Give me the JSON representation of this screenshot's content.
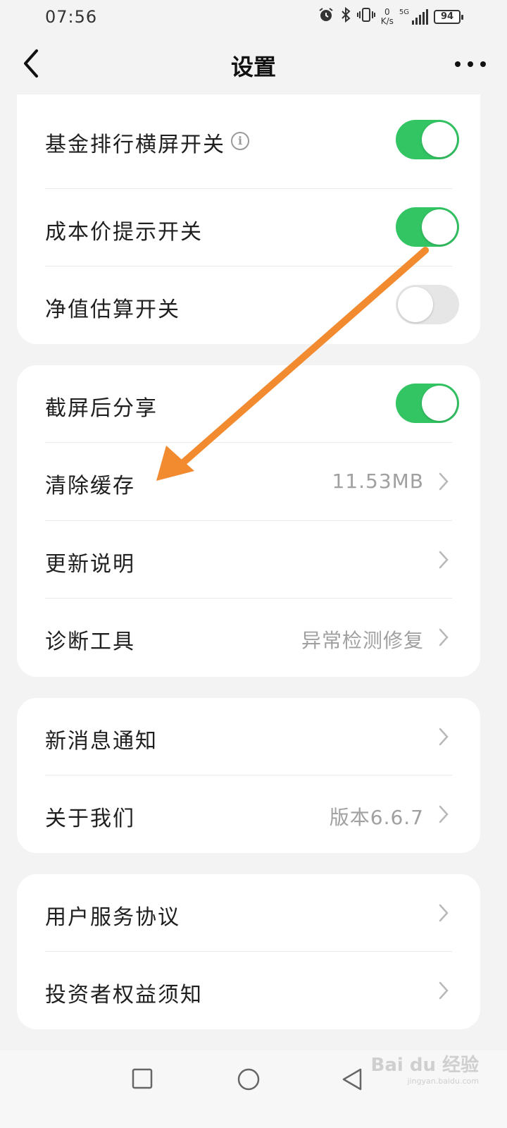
{
  "status_bar": {
    "time": "07:56",
    "net_speed_value": "0",
    "net_speed_unit": "K/s",
    "network_type": "5G",
    "battery": "94",
    "icons": [
      "alarm-icon",
      "bluetooth-icon",
      "vibrate-icon",
      "signal-icon",
      "battery-icon"
    ]
  },
  "header": {
    "title": "设置",
    "back_icon": "back-arrow-icon",
    "more_icon": "more-icon"
  },
  "sections": [
    {
      "items": [
        {
          "label": "基金排行横屏开关",
          "info": true,
          "control": "toggle",
          "state": "on"
        },
        {
          "label": "成本价提示开关",
          "control": "toggle",
          "state": "on"
        },
        {
          "label": "净值估算开关",
          "control": "toggle",
          "state": "off"
        }
      ]
    },
    {
      "items": [
        {
          "label": "截屏后分享",
          "control": "toggle",
          "state": "on"
        },
        {
          "label": "清除缓存",
          "value": "11.53MB",
          "control": "chevron"
        },
        {
          "label": "更新说明",
          "value": "",
          "control": "chevron"
        },
        {
          "label": "诊断工具",
          "value": "异常检测修复",
          "control": "chevron"
        }
      ]
    },
    {
      "items": [
        {
          "label": "新消息通知",
          "value": "",
          "control": "chevron"
        },
        {
          "label": "关于我们",
          "value": "版本6.6.7",
          "control": "chevron"
        }
      ]
    },
    {
      "items": [
        {
          "label": "用户服务协议",
          "value": "",
          "control": "chevron"
        },
        {
          "label": "投资者权益须知",
          "value": "",
          "control": "chevron"
        }
      ]
    }
  ],
  "info_icon_glyph": "i",
  "colors": {
    "toggle_on": "#33c463",
    "toggle_off": "#e6e6e6",
    "annotation_arrow": "#f28a30",
    "value_text": "#a0a0a0"
  },
  "system_nav": [
    "recent-apps-icon",
    "home-icon",
    "back-icon"
  ],
  "watermark": {
    "main": "Bai du 经验",
    "sub": "jingyan.baidu.com"
  }
}
